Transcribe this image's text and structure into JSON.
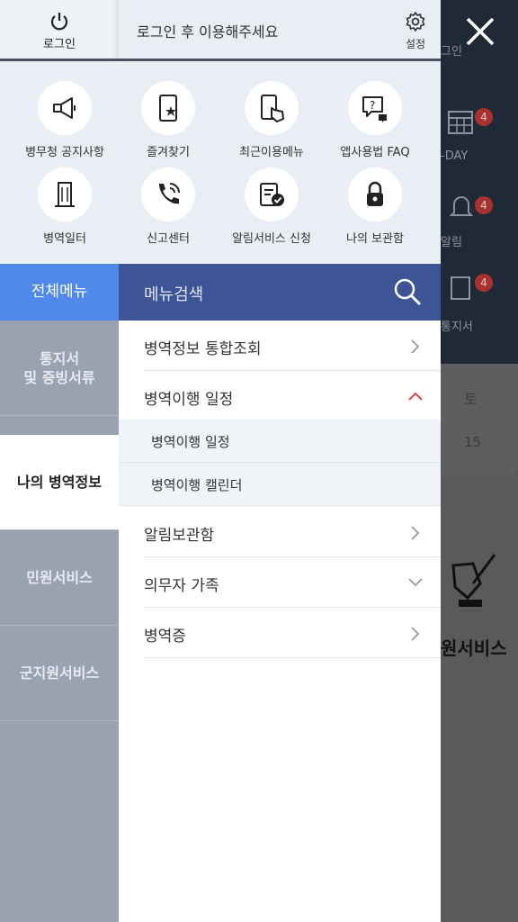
{
  "background": {
    "today_label": "-DAY",
    "alarm_label": "알림",
    "notice_label": "통지서",
    "badges": [
      "4",
      "4",
      "4"
    ],
    "saturday": "토",
    "date_number": "15",
    "service_label": "원서비스",
    "login_ghost": "그인"
  },
  "header": {
    "login_label": "로그인",
    "login_message": "로그인 후 이용해주세요",
    "settings_label": "설정"
  },
  "quick_menu": [
    {
      "label": "병무청 공지사항",
      "icon": "megaphone-icon"
    },
    {
      "label": "즐겨찾기",
      "icon": "star-phone-icon"
    },
    {
      "label": "최근이용메뉴",
      "icon": "touch-phone-icon"
    },
    {
      "label": "앱사용법 FAQ",
      "icon": "faq-bubble-icon"
    },
    {
      "label": "병역일터",
      "icon": "building-icon"
    },
    {
      "label": "신고센터",
      "icon": "phone-call-icon"
    },
    {
      "label": "알림서비스 신청",
      "icon": "checked-document-icon"
    },
    {
      "label": "나의 보관함",
      "icon": "lock-icon"
    }
  ],
  "tabs": {
    "all_menu": "전체메뉴",
    "menu_search": "메뉴검색"
  },
  "sidebar": {
    "items": [
      {
        "label_line1": "통지서",
        "label_line2": "및 증빙서류"
      },
      {
        "label": "나의 병역정보"
      },
      {
        "label": "민원서비스"
      },
      {
        "label": "군지원서비스"
      }
    ]
  },
  "menu": {
    "items": [
      {
        "label": "병역정보 통합조회"
      },
      {
        "label": "병역이행 일정"
      },
      {
        "label": "알림보관함"
      },
      {
        "label": "의무자 가족"
      },
      {
        "label": "병역증"
      }
    ],
    "subitems": [
      {
        "label": "병역이행 일정"
      },
      {
        "label": "병역이행 캘린더"
      }
    ]
  },
  "colors": {
    "accent_blue": "#4f8ae8",
    "search_bar": "#3e5595",
    "expand_arrow": "#e0463c"
  }
}
